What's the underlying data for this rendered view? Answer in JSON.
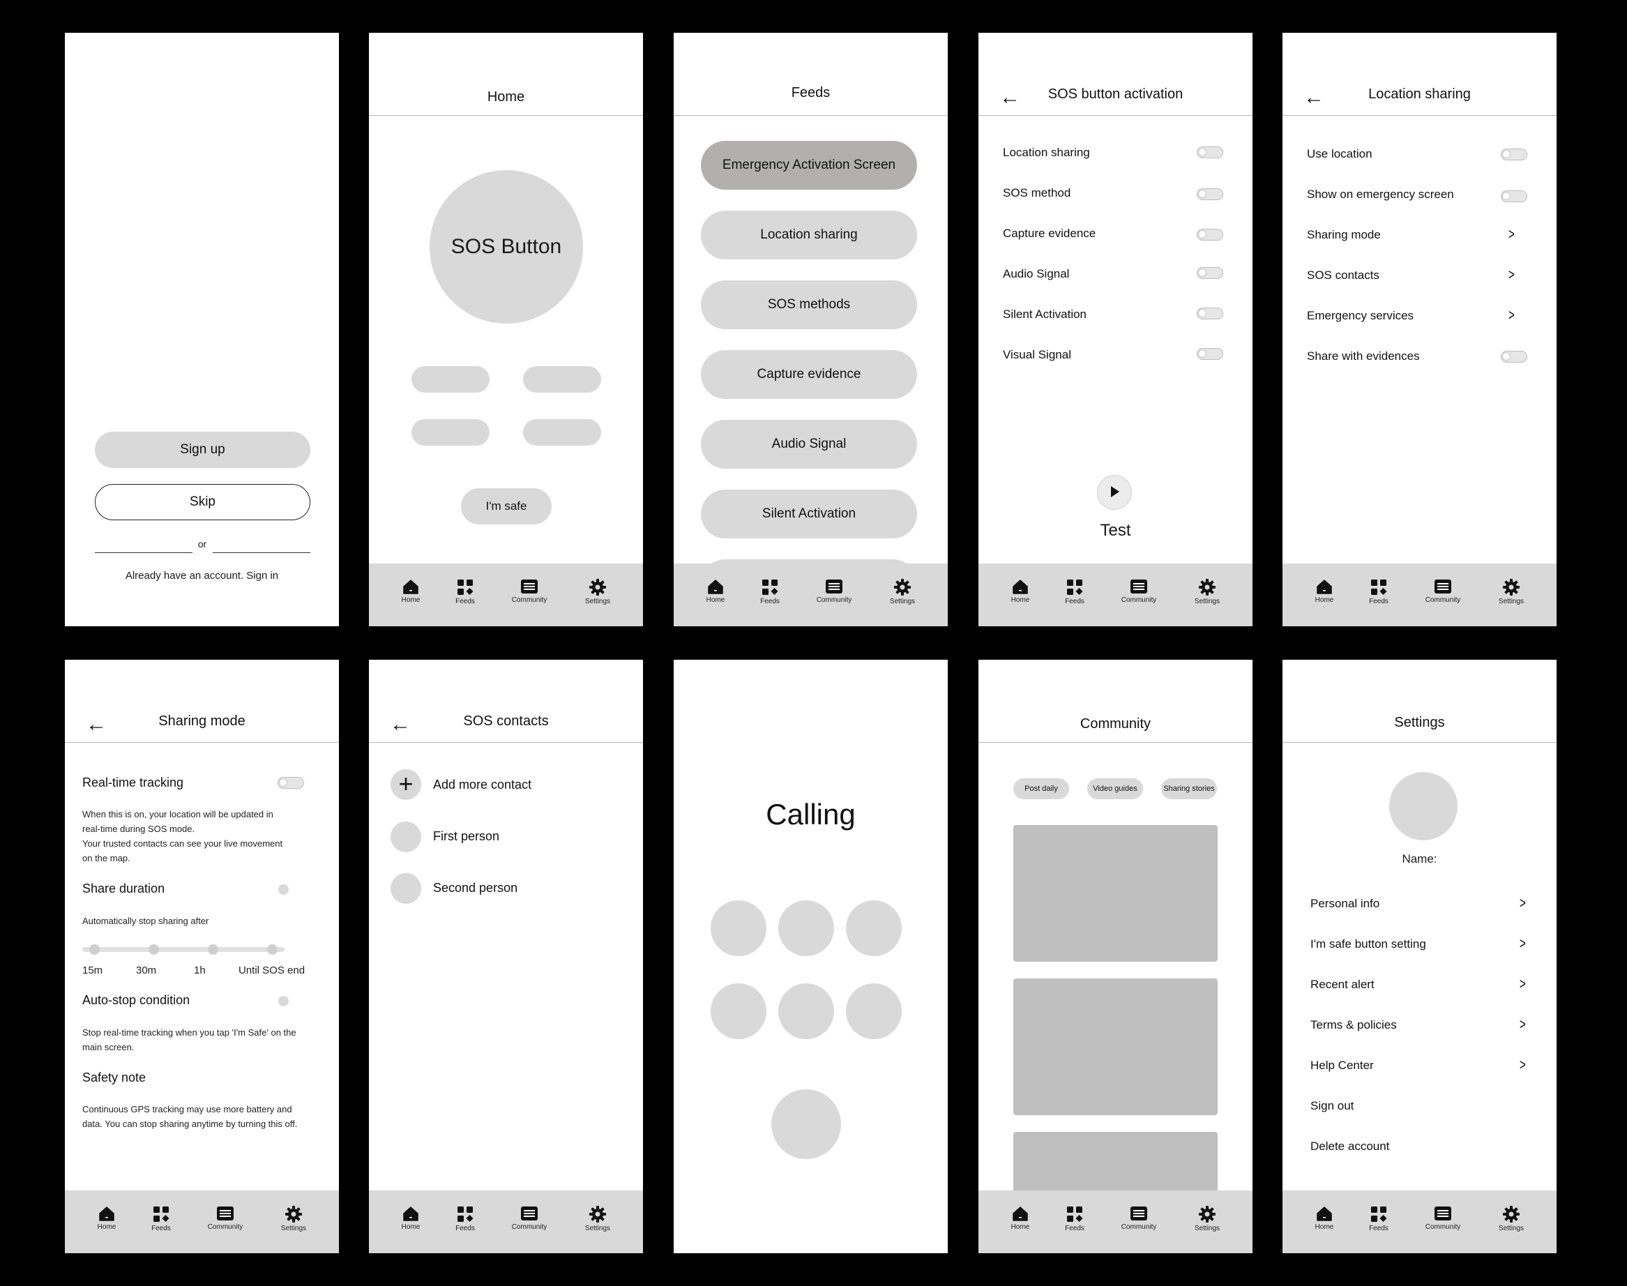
{
  "nav": {
    "home": "Home",
    "feeds": "Feeds",
    "community": "Community",
    "settings": "Settings"
  },
  "screen1": {
    "signup": "Sign up",
    "skip": "Skip",
    "or": "or",
    "signin_text": "Already have an account.  Sign in"
  },
  "screen2": {
    "title": "Home",
    "sos_button": "SOS Button",
    "im_safe": "I'm safe"
  },
  "screen3": {
    "title": "Feeds",
    "items": [
      "Emergency Activation Screen",
      "Location sharing",
      "SOS methods",
      "Capture evidence",
      "Audio Signal",
      "Silent Activation"
    ]
  },
  "screen4": {
    "title": "SOS button activation",
    "items": [
      "Location sharing",
      "SOS method",
      "Capture evidence",
      "Audio Signal",
      "Silent Activation",
      "Visual Signal"
    ],
    "test": "Test"
  },
  "screen5": {
    "title": "Location sharing",
    "items": [
      "Use location",
      "Show on emergency screen",
      "Sharing mode",
      "SOS contacts",
      "Emergency services",
      "Share with evidences"
    ]
  },
  "screen6": {
    "title": "Sharing mode",
    "realtime": "Real-time tracking",
    "realtime_desc": [
      "When this is on, your location will be updated in",
      "real-time during SOS mode.",
      "Your trusted contacts can see your live movement",
      "on the map."
    ],
    "share_duration": "Share duration",
    "auto_stop_after": "Automatically stop sharing after",
    "durations": [
      "15m",
      "30m",
      "1h",
      "Until SOS end"
    ],
    "auto_stop": "Auto-stop condition",
    "auto_stop_desc": [
      "Stop real-time tracking when you tap 'I'm Safe' on the",
      "main screen."
    ],
    "safety_note": "Safety note",
    "safety_desc": [
      "Continuous GPS tracking may use more battery and",
      "data.  You can stop sharing anytime by turning this off."
    ]
  },
  "screen7": {
    "title": "SOS contacts",
    "add": "Add more contact",
    "first": "First person",
    "second": "Second person"
  },
  "screen8": {
    "calling": "Calling"
  },
  "screen9": {
    "title": "Community",
    "chips": [
      "Post daily",
      "Video guides",
      "Sharing stories"
    ]
  },
  "screen10": {
    "title": "Settings",
    "name": "Name:",
    "items": [
      "Personal info",
      "I'm safe button setting",
      "Recent alert",
      "Terms & policies",
      "Help Center",
      "Sign out",
      "Delete account"
    ]
  }
}
